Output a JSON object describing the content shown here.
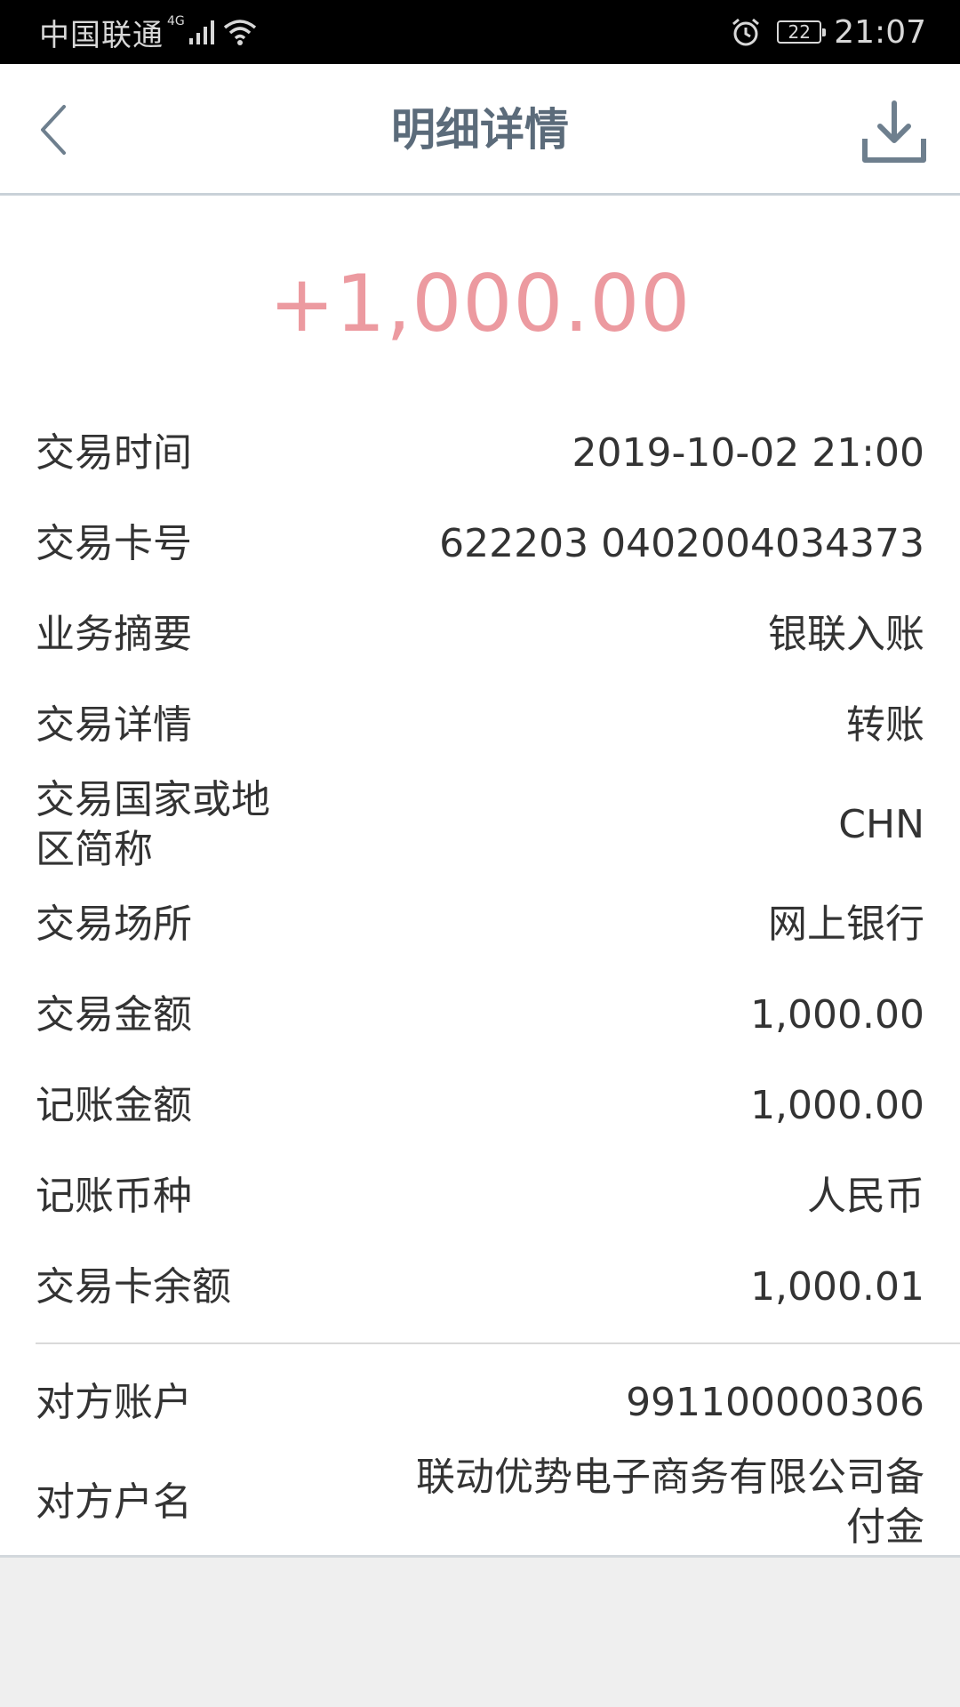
{
  "status_bar": {
    "carrier": "中国联通",
    "network_type": "4G",
    "battery_level": "22",
    "time": "21:07",
    "icons": [
      "signal-icon",
      "wifi-icon",
      "alarm-icon",
      "battery-icon"
    ]
  },
  "header": {
    "title": "明细详情",
    "back_icon": "chevron-left-icon",
    "download_icon": "download-icon"
  },
  "colors": {
    "amount": "#ec9aa0",
    "title": "#5b6b7a",
    "icon": "#6e7f8e"
  },
  "amount": "+1,000.00",
  "details": [
    {
      "label": "交易时间",
      "value": "2019-10-02 21:00"
    },
    {
      "label": "交易卡号",
      "value": "622203 0402004034373"
    },
    {
      "label": "业务摘要",
      "value": "银联入账"
    },
    {
      "label": "交易详情",
      "value": "转账"
    },
    {
      "label_line1": "交易国家或地",
      "label_line2": "区简称",
      "value": "CHN"
    },
    {
      "label": "交易场所",
      "value": "网上银行"
    },
    {
      "label": "交易金额",
      "value": "1,000.00"
    },
    {
      "label": "记账金额",
      "value": "1,000.00"
    },
    {
      "label": "记账币种",
      "value": "人民币"
    },
    {
      "label": "交易卡余额",
      "value": "1,000.01"
    }
  ],
  "counterparty": [
    {
      "label": "对方账户",
      "value": "991100000306"
    },
    {
      "label": "对方户名",
      "value_line1": "联动优势电子商务有限公司备",
      "value_line2": "付金"
    }
  ]
}
